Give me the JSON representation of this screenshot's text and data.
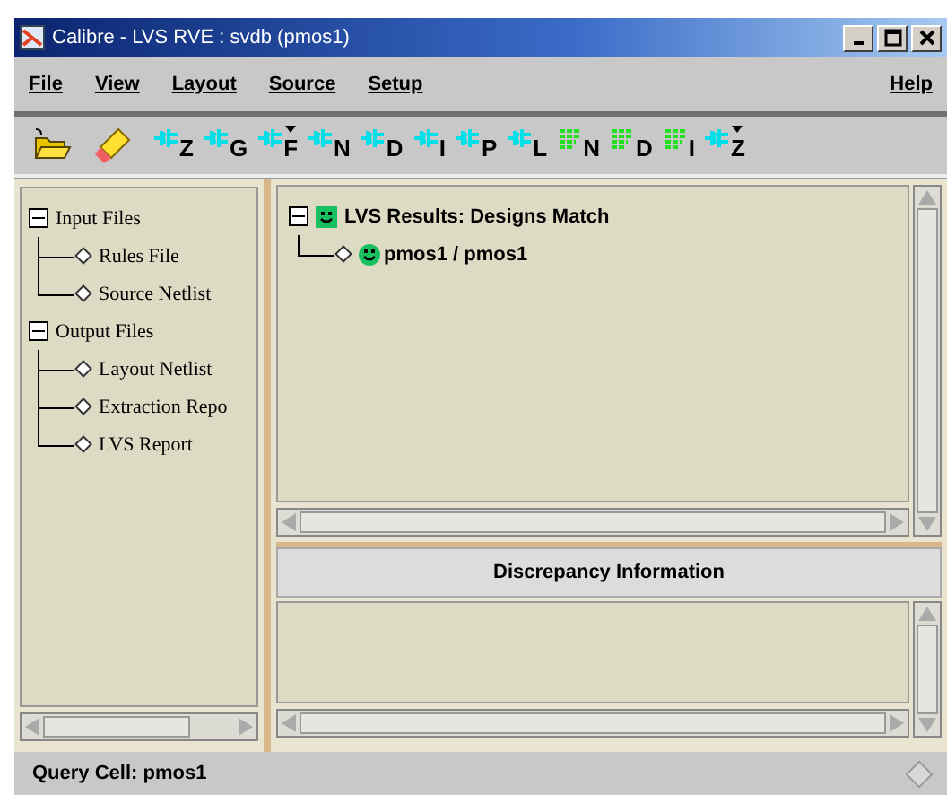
{
  "window": {
    "title": "Calibre - LVS RVE : svdb (pmos1)"
  },
  "menu": [
    {
      "label": "File"
    },
    {
      "label": "View"
    },
    {
      "label": "Layout"
    },
    {
      "label": "Source"
    },
    {
      "label": "Setup"
    },
    {
      "label": "Help",
      "kind": "right"
    }
  ],
  "toolbar": [
    {
      "kind": "folder"
    },
    {
      "kind": "highlighter"
    },
    {
      "kind": "net",
      "letter": "Z",
      "dropdown": false
    },
    {
      "kind": "net",
      "letter": "G",
      "dropdown": false
    },
    {
      "kind": "net",
      "letter": "F",
      "dropdown": true
    },
    {
      "kind": "net",
      "letter": "N",
      "dropdown": false
    },
    {
      "kind": "net",
      "letter": "D",
      "dropdown": false
    },
    {
      "kind": "net",
      "letter": "I",
      "dropdown": false
    },
    {
      "kind": "net",
      "letter": "P",
      "dropdown": false
    },
    {
      "kind": "net",
      "letter": "L",
      "dropdown": false
    },
    {
      "kind": "grid",
      "letter": "N",
      "dropdown": false
    },
    {
      "kind": "grid",
      "letter": "D",
      "dropdown": false
    },
    {
      "kind": "grid",
      "letter": "I",
      "dropdown": false
    },
    {
      "kind": "net",
      "letter": "Z",
      "dropdown": true
    }
  ],
  "file_tree": [
    {
      "label": "Input Files",
      "expanded": true,
      "children": [
        {
          "label": "Rules File"
        },
        {
          "label": "Source Netlist"
        }
      ]
    },
    {
      "label": "Output Files",
      "expanded": true,
      "children": [
        {
          "label": "Layout Netlist"
        },
        {
          "label": "Extraction Repo"
        },
        {
          "label": "LVS Report"
        }
      ]
    }
  ],
  "results_tree": [
    {
      "label": "LVS Results: Designs Match",
      "expanded": true,
      "children": [
        {
          "label": "pmos1 / pmos1"
        }
      ]
    }
  ],
  "discrepancy": {
    "title": "Discrepancy Information"
  },
  "status_bar": {
    "text": "Query Cell: pmos1"
  }
}
